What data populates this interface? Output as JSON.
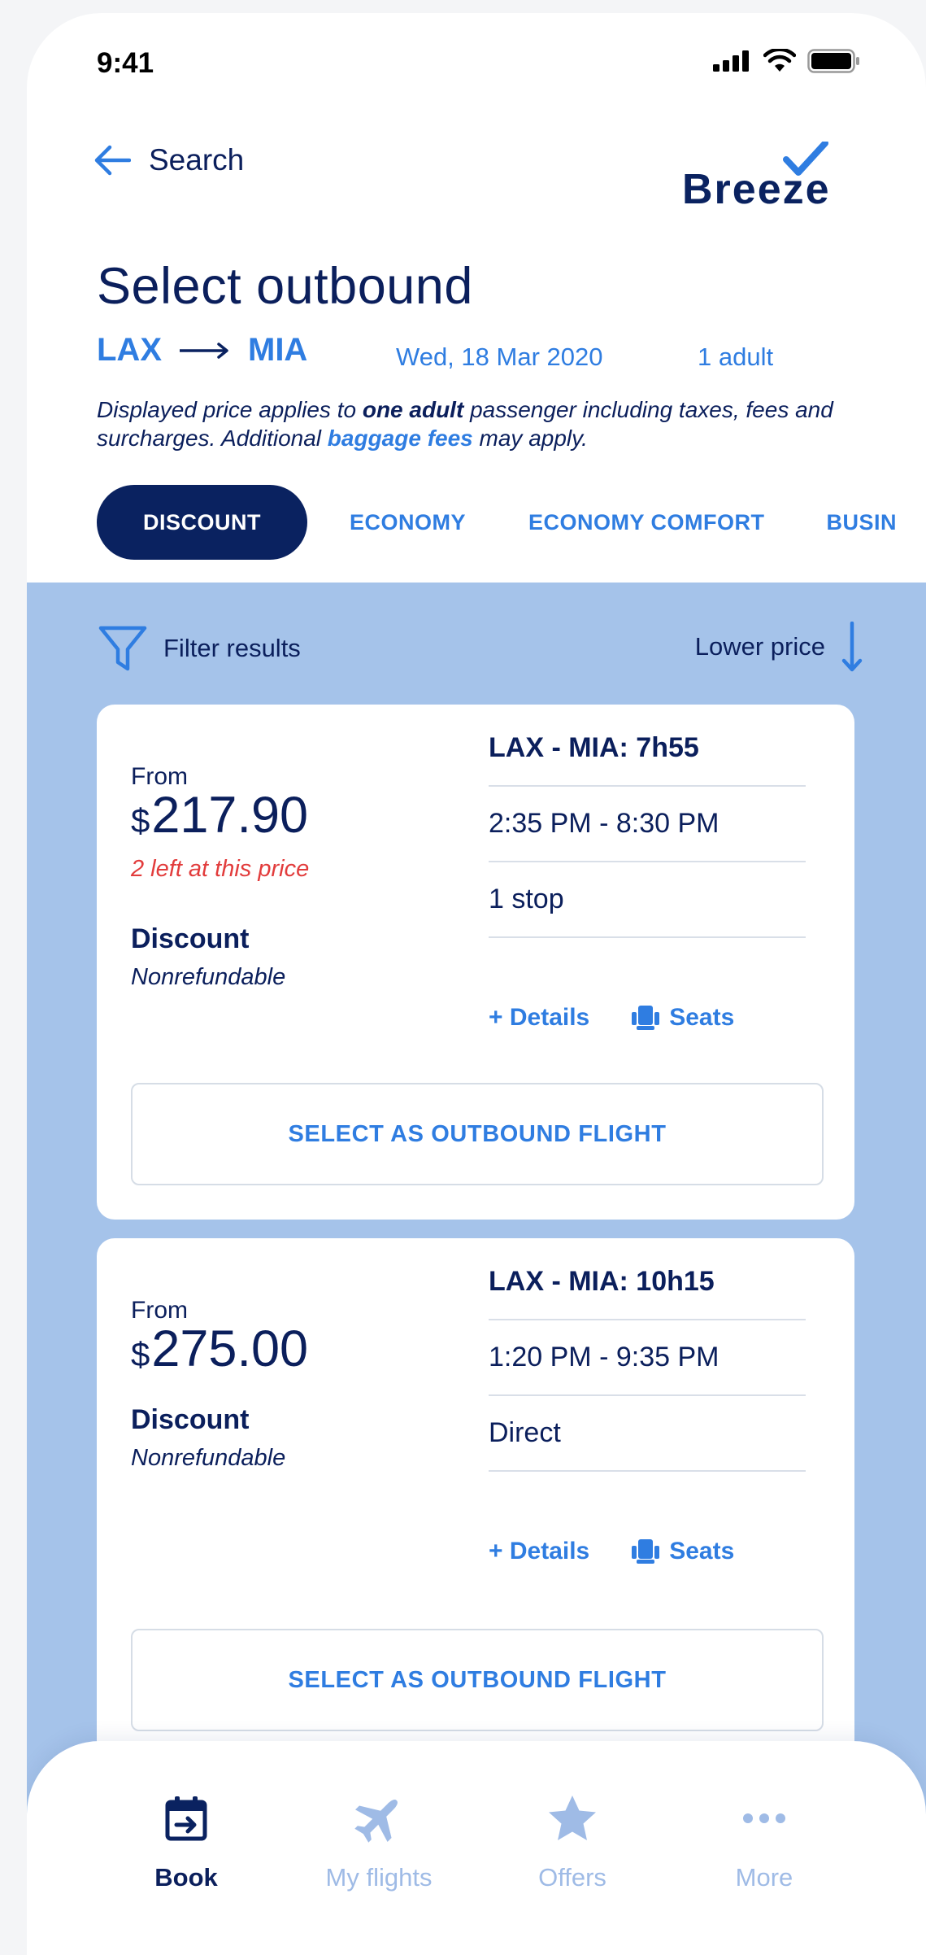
{
  "status": {
    "time": "9:41"
  },
  "nav": {
    "back_label": "Search",
    "logo_text": "Breeze"
  },
  "page": {
    "title": "Select outbound"
  },
  "route": {
    "origin": "LAX",
    "destination": "MIA",
    "date": "Wed, 18 Mar 2020",
    "passengers": "1 adult"
  },
  "disclaimer": {
    "part1": "Displayed price applies to ",
    "bold1": "one adult",
    "part2": " passenger including taxes, fees and surcharges. Additional ",
    "link": "baggage fees",
    "part3": " may apply."
  },
  "fare_tabs": [
    "DISCOUNT",
    "ECONOMY",
    "ECONOMY COMFORT",
    "BUSIN"
  ],
  "fare_tabs_active": "DISCOUNT",
  "filter": {
    "label": "Filter results"
  },
  "sort": {
    "label": "Lower price"
  },
  "flights": [
    {
      "from_label": "From",
      "currency": "$",
      "price": "217.90",
      "scarcity": "2 left at this price",
      "fare_name": "Discount",
      "fare_condition": "Nonrefundable",
      "route_duration": "LAX - MIA: 7h55",
      "times": "2:35 PM - 8:30 PM",
      "stops": "1 stop",
      "details_label": "+ Details",
      "seats_label": "Seats",
      "select_label": "SELECT AS OUTBOUND FLIGHT"
    },
    {
      "from_label": "From",
      "currency": "$",
      "price": "275.00",
      "scarcity": "",
      "fare_name": "Discount",
      "fare_condition": "Nonrefundable",
      "route_duration": "LAX - MIA: 10h15",
      "times": "1:20 PM - 9:35 PM",
      "stops": "Direct",
      "details_label": "+ Details",
      "seats_label": "Seats",
      "select_label": "SELECT AS OUTBOUND FLIGHT"
    }
  ],
  "tabbar": {
    "items": [
      {
        "label": "Book",
        "icon": "calendar-arrow-icon",
        "active": true
      },
      {
        "label": "My flights",
        "icon": "airplane-icon",
        "active": false
      },
      {
        "label": "Offers",
        "icon": "star-icon",
        "active": false
      },
      {
        "label": "More",
        "icon": "ellipsis-icon",
        "active": false
      }
    ]
  },
  "colors": {
    "navy": "#0a2260",
    "accent": "#2f7de1",
    "results_bg": "#a5c3ea",
    "warning": "#e23c3c"
  }
}
